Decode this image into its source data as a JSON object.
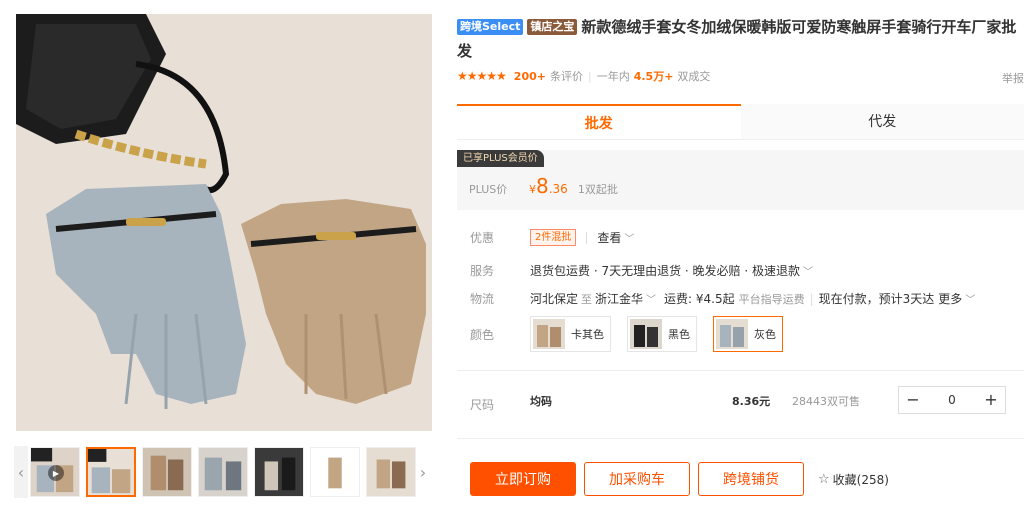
{
  "gallery": {
    "thumb_count": 7,
    "active_thumb": 1,
    "prev_arrow": "‹",
    "next_arrow": "›",
    "play_icon": "▶"
  },
  "title": {
    "tags": [
      "跨境Select",
      "镇店之宝"
    ],
    "text": "新款德绒手套女冬加绒保暖韩版可爱防寒触屏手套骑行开车厂家批发"
  },
  "rating": {
    "stars": "★★★★★",
    "review_count": "200+",
    "review_label": "条评价",
    "year_label": "一年内",
    "deals_count": "4.5万+",
    "deals_label": "双成交",
    "report": "举报"
  },
  "tabs": [
    {
      "label": "批发"
    },
    {
      "label": "代发"
    }
  ],
  "price": {
    "plus_tag": "已享PLUS会员价",
    "label": "PLUS价",
    "symbol": "¥",
    "integer": "8",
    "decimal": ".36",
    "min_order": "1双起批"
  },
  "offers": {
    "label": "优惠",
    "tag": "2件混批",
    "view": "查看"
  },
  "service": {
    "label": "服务",
    "text": "退货包运费 · 7天无理由退货 · 晚发必赔 · 极速退款"
  },
  "logistics": {
    "label": "物流",
    "from": "河北保定",
    "to_word": "至",
    "to": "浙江金华",
    "freight_label": "运费: ¥4.5起",
    "freight_note": "平台指导运费",
    "eta": "现在付款，预计3天达",
    "more": "更多"
  },
  "color": {
    "label": "颜色",
    "options": [
      {
        "name": "卡其色",
        "selected": false
      },
      {
        "name": "黑色",
        "selected": false
      },
      {
        "name": "灰色",
        "selected": true
      }
    ]
  },
  "size": {
    "label": "尺码",
    "name": "均码",
    "price": "8.36元",
    "stock": "28443双可售",
    "quantity": "0",
    "minus": "−",
    "plus": "+"
  },
  "actions": {
    "buy": "立即订购",
    "cart": "加采购车",
    "crossborder": "跨境铺货",
    "favorite": "收藏(258)"
  },
  "colors": {
    "accent": "#ff5000",
    "grey_glove": "#a7b3bd",
    "khaki_glove": "#c2a585"
  }
}
